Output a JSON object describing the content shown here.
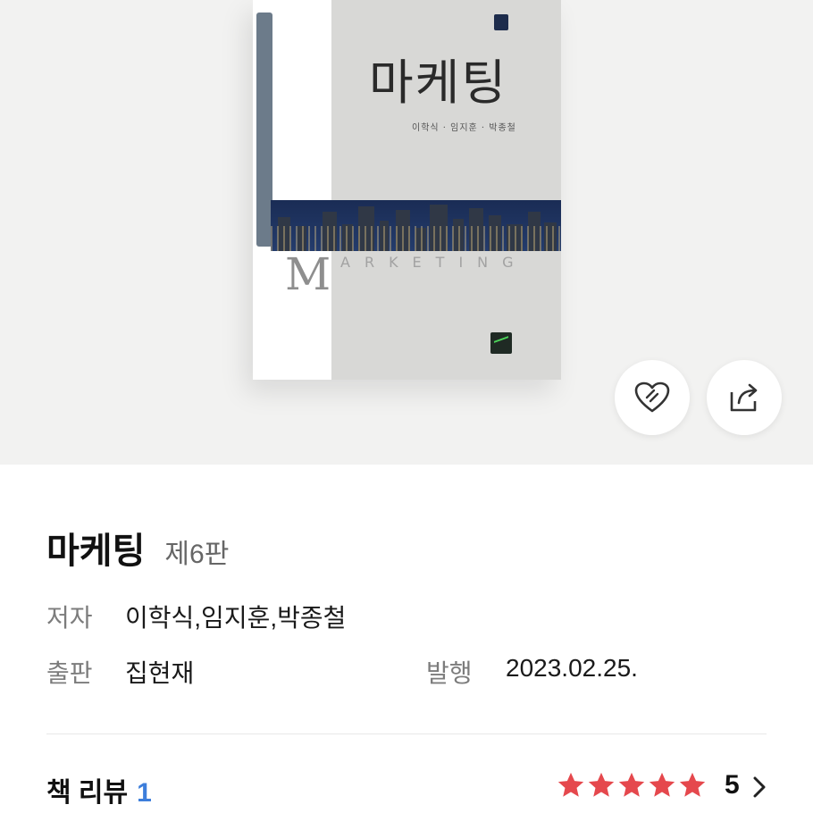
{
  "cover": {
    "title": "마케팅",
    "authors": "이학식 · 임지훈 · 박종철",
    "letter_m": "M",
    "subtitle_rest": "ARKETING"
  },
  "actions": {
    "like_icon": "heart-icon",
    "share_icon": "share-icon"
  },
  "book": {
    "title": "마케팅",
    "edition": "제6판",
    "author_label": "저자",
    "author_value": "이학식,임지훈,박종철",
    "publisher_label": "출판",
    "publisher_value": "집현재",
    "date_label": "발행",
    "date_value": "2023.02.25."
  },
  "review": {
    "label": "책 리뷰",
    "count": "1",
    "rating": "5",
    "stars_filled": 5,
    "star_color": "#e5484d"
  }
}
